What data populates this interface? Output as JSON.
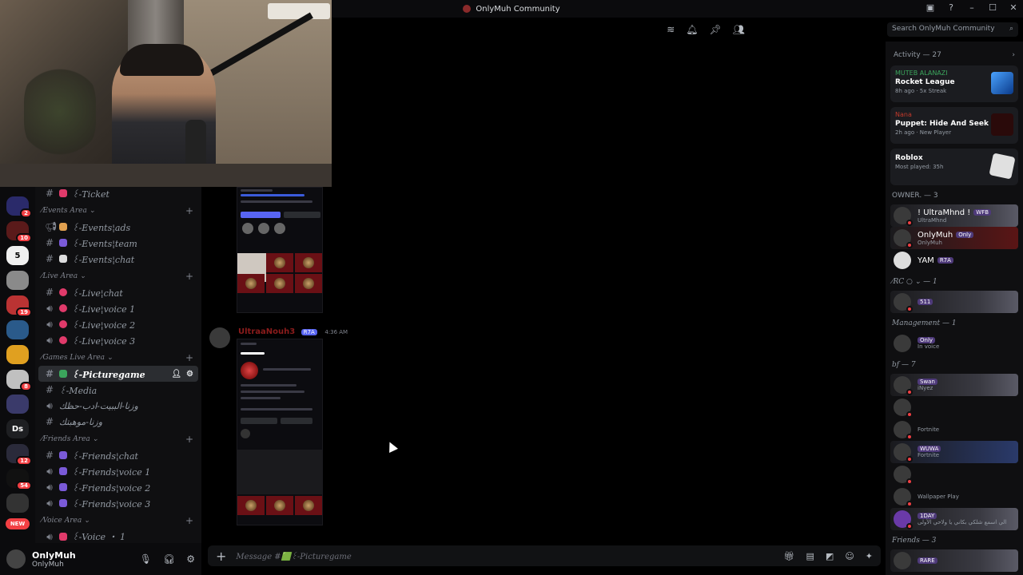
{
  "window": {
    "title": "OnlyMuh Community"
  },
  "search": {
    "placeholder": "Search OnlyMuh Community"
  },
  "servers": [
    {
      "label": "",
      "badge": "2"
    },
    {
      "label": "",
      "badge": "10"
    },
    {
      "label": "5",
      "badge": ""
    },
    {
      "label": "",
      "badge": ""
    },
    {
      "label": "",
      "badge": "19"
    },
    {
      "label": "",
      "badge": ""
    },
    {
      "label": "",
      "badge": ""
    },
    {
      "label": "",
      "badge": "8"
    },
    {
      "label": "",
      "badge": ""
    },
    {
      "label": "Ds",
      "badge": ""
    },
    {
      "label": "",
      "badge": "12"
    },
    {
      "label": "",
      "badge": "54"
    },
    {
      "label": "",
      "badge": ""
    }
  ],
  "server_new_label": "NEW",
  "channels": {
    "ticket": "꒰-Ticket",
    "cat_events": "⁄Events Area ⌄",
    "events_ads": "꒰-Events¦ads",
    "events_team": "꒰-Events¦team",
    "events_chat": "꒰-Events¦chat",
    "cat_live": "⁄Live Area ⌄",
    "live_chat": "꒰-Live¦chat",
    "live_voice1": "꒰-Live¦voice 1",
    "live_voice2": "꒰-Live¦voice 2",
    "live_voice3": "꒰-Live¦voice 3",
    "cat_games": "⁄Games Live Area ⌄",
    "picturegame": "꒰-Picturegame",
    "media": "꒰-Media",
    "arabic1": "وزنا-الببيت-ادب-حظك",
    "arabic2": "وزنا-موهبتك",
    "cat_friends": "⁄Friends Area ⌄",
    "friends_chat": "꒰-Friends¦chat",
    "friends_voice1": "꒰-Friends¦voice 1",
    "friends_voice2": "꒰-Friends¦voice 2",
    "friends_voice3": "꒰-Friends¦voice 3",
    "cat_voice": "⁄Voice Area ⌄",
    "voice1": "꒰-Voice ・ 1"
  },
  "user": {
    "name": "OnlyMuh",
    "status": "OnlyMuh"
  },
  "message": {
    "author": "UltraaNouh3",
    "tag": "R7A",
    "time": "4:36 AM"
  },
  "composer": {
    "placeholder": "Message #🟩꒰-Picturegame"
  },
  "members": {
    "activity_header": "Activity — 27",
    "activities": [
      {
        "who": "MUTEB ALANAZI",
        "game": "Rocket League",
        "meta": "8h ago · 5x Streak",
        "color": "#3ba55c"
      },
      {
        "who": "Nana",
        "game": "Puppet: Hide And Seek",
        "meta": "2h ago · New Player",
        "color": "#c0392b"
      },
      {
        "who": "",
        "game": "Roblox",
        "meta": "Most played: 35h",
        "color": "#3ba55c"
      }
    ],
    "owner_header": "OWNER. — 3",
    "owners": [
      {
        "name": "! UltraMhnd !",
        "tag": "WFB",
        "sub": "UltraMhnd"
      },
      {
        "name": "OnlyMuh",
        "tag": "Only",
        "sub": "OnlyMuh"
      },
      {
        "name": "YAM",
        "tag": "R7A",
        "sub": ""
      }
    ],
    "rc_header": "⁄RC ○ ⌄ — 1",
    "rc_member": {
      "name": "",
      "tag": "511",
      "sub": ""
    },
    "mgmt_header": "Management — 1",
    "mgmt_member": {
      "name": "",
      "tag": "Only",
      "sub": "In voice"
    },
    "bf_header": "bf — 7",
    "bf_members": [
      {
        "name": "",
        "tag": "Swan",
        "sub": "iNyez"
      },
      {
        "name": "",
        "tag": "",
        "sub": ""
      },
      {
        "name": "",
        "tag": "",
        "sub": "Fortnite"
      },
      {
        "name": "",
        "tag": "WUWA",
        "sub": "Fortnite"
      },
      {
        "name": "",
        "tag": "",
        "sub": ""
      },
      {
        "name": "",
        "tag": "",
        "sub": "Wallpaper Play"
      },
      {
        "name": "",
        "tag": "1DAY",
        "sub": "الي اسمع شلكي بكاني يا ولاحي الأولى"
      }
    ],
    "friends_header": "Friends — 3",
    "friends_tag": "RARE"
  }
}
